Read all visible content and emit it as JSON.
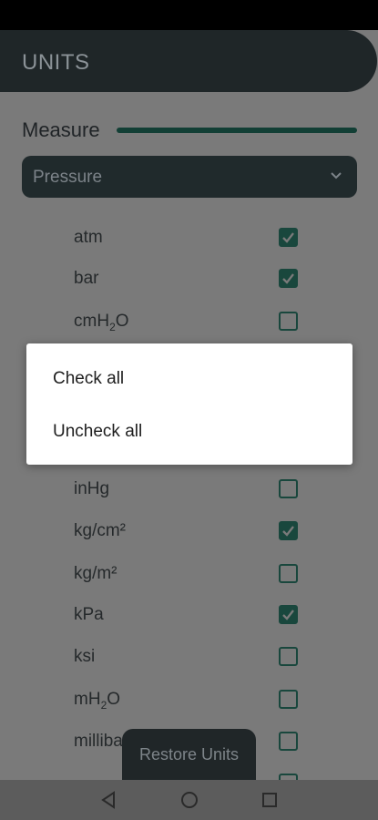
{
  "header": {
    "title": "UNITS"
  },
  "measure": {
    "label": "Measure",
    "selected": "Pressure"
  },
  "units": [
    {
      "name": "atm",
      "sub": "",
      "checked": true
    },
    {
      "name": "bar",
      "sub": "",
      "checked": true
    },
    {
      "name": "cmH",
      "sub": "2",
      "suffix": "O",
      "checked": false
    },
    {
      "name": "inHg",
      "sub": "",
      "checked": false
    },
    {
      "name": "kg/cm²",
      "sub": "",
      "checked": true
    },
    {
      "name": "kg/m²",
      "sub": "",
      "checked": false
    },
    {
      "name": "kPa",
      "sub": "",
      "checked": true
    },
    {
      "name": "ksi",
      "sub": "",
      "checked": false
    },
    {
      "name": "mH",
      "sub": "2",
      "suffix": "O",
      "checked": false
    },
    {
      "name": "milliba",
      "sub": "",
      "checked": false
    },
    {
      "name": "",
      "sub": "",
      "checked": false
    }
  ],
  "popup": {
    "check_all": "Check all",
    "uncheck_all": "Uncheck all"
  },
  "restore": {
    "label": "Restore Units"
  },
  "colors": {
    "accent": "#19473d",
    "header_bg": "#1f2628",
    "overlay_bg": "#7a7a7a"
  }
}
